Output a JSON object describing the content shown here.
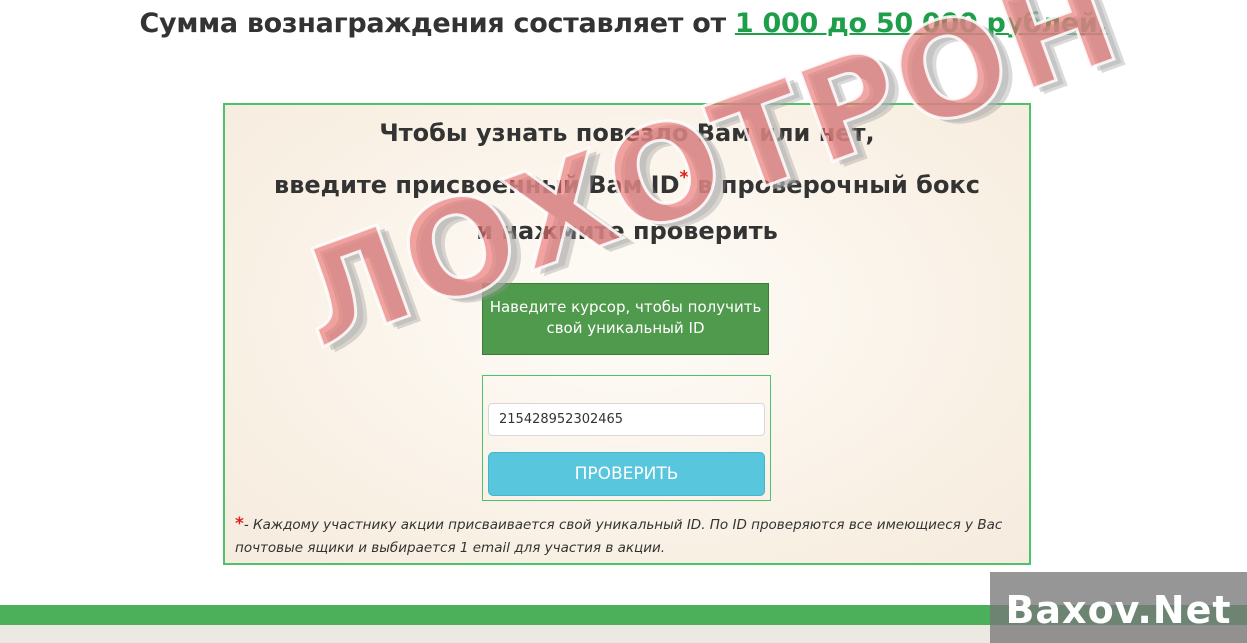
{
  "headline": {
    "text": "Сумма вознаграждения составляет от ",
    "link": "1 000 до 50 000 рублей."
  },
  "promo": {
    "line1": "Чтобы узнать повезло Вам или нет,",
    "line2_pre": "введите присвоенный Вам ID",
    "line2_ast": "*",
    "line2_post": " в проверочный бокс",
    "line3": "и нажмите проверить",
    "hover_text": "Наведите  курсор, чтобы получить свой уникальный ID",
    "id_value": "215428952302465",
    "check_button": "ПРОВЕРИТЬ",
    "footnote_ast": "*",
    "footnote": "- Каждому участнику акции присваивается свой уникальный ID. По ID проверяются все имеющиеся у Вас почтовые ящики и выбирается 1 email для участия в акции."
  },
  "stamp": {
    "text": "ЛОХОТРОН"
  },
  "watermark": {
    "text": "Baxov.Net"
  },
  "colors": {
    "accent_green": "#1e9e4a",
    "border_green": "#4cc36a",
    "hover_green": "#4f9a4c",
    "button_blue": "#58c6dd",
    "asterisk_red": "#e02020"
  }
}
